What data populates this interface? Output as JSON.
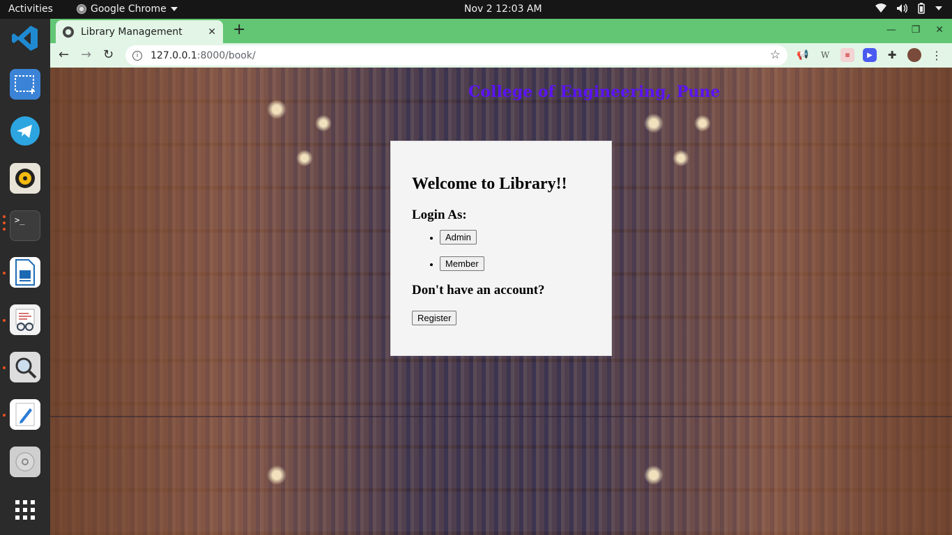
{
  "system": {
    "activities": "Activities",
    "app_name": "Google Chrome",
    "clock": "Nov 2  12:03 AM"
  },
  "browser": {
    "tab_title": "Library Management",
    "new_tab": "+",
    "url_host": "127.0.0.1",
    "url_path": ":8000/book/"
  },
  "page": {
    "college": "College of Engineering, Pune",
    "welcome": "Welcome to Library!!",
    "login_as": "Login As:",
    "admin_button": "Admin",
    "member_button": "Member",
    "no_account": "Don't have an account?",
    "register_button": "Register"
  },
  "colors": {
    "tabstrip": "#62c674",
    "college_text": "#5b13f5"
  }
}
